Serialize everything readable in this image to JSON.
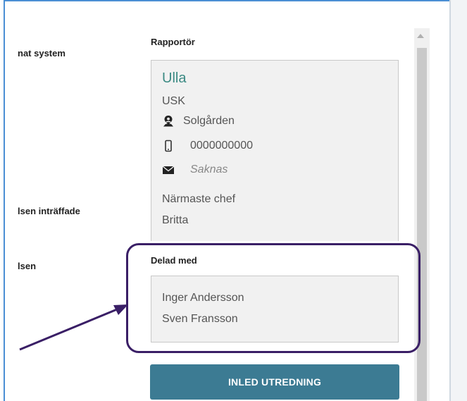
{
  "left_labels": {
    "system": "nat system",
    "occurred": "lsen inträffade",
    "event": "lsen"
  },
  "reporter": {
    "heading": "Rapportör",
    "name": "Ulla",
    "role": "USK",
    "location": "Solgården",
    "phone": "0000000000",
    "email": "Saknas",
    "manager_label": "Närmaste chef",
    "manager_name": "Britta"
  },
  "shared": {
    "heading": "Delad med",
    "people": [
      "Inger Andersson",
      "Sven Fransson"
    ]
  },
  "action_button": "INLED UTREDNING",
  "icons": [
    "location-pin-person-icon",
    "mobile-phone-icon",
    "envelope-icon",
    "scroll-up-arrow-icon"
  ],
  "colors": {
    "accent_name": "#3b8a83",
    "button": "#3c7b93",
    "highlight": "#3a1f66"
  }
}
